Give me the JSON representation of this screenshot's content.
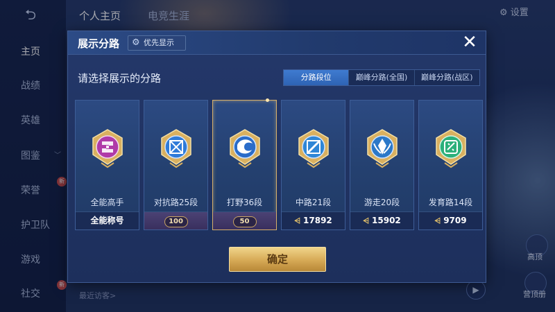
{
  "background": {
    "back_label": "⮌",
    "nav": [
      {
        "label": "主页",
        "active": true
      },
      {
        "label": "战绩"
      },
      {
        "label": "英雄"
      },
      {
        "label": "图鉴"
      },
      {
        "label": "荣誉"
      },
      {
        "label": "护卫队"
      },
      {
        "label": "游戏"
      },
      {
        "label": "社交"
      }
    ],
    "new_badge": "新",
    "top_tabs": [
      "个人主页",
      "电竞生涯"
    ],
    "settings_label": "设置",
    "recent_visitor": "最近访客>",
    "side_labels": [
      "高顶",
      "营顶册"
    ]
  },
  "modal": {
    "title": "展示分路",
    "priority_label": "优先显示",
    "close_label": "✕",
    "subtitle": "请选择展示的分路",
    "segments": [
      "分路段位",
      "巅峰分路(全国)",
      "巅峰分路(战区)"
    ],
    "active_segment": 0,
    "cards": [
      {
        "name": "全能高手",
        "foot": "全能称号",
        "foot_type": "text",
        "badge_color": "#b03aa8"
      },
      {
        "name": "对抗路25段",
        "foot": "100",
        "foot_type": "plate",
        "badge_color": "#2f7bd8"
      },
      {
        "name": "打野36段",
        "foot": "50",
        "foot_type": "plate",
        "badge_color": "#2a6cc9",
        "selected": true
      },
      {
        "name": "中路21段",
        "foot": "17892",
        "foot_type": "score",
        "badge_color": "#2e86d6"
      },
      {
        "name": "游走20段",
        "foot": "15902",
        "foot_type": "score",
        "badge_color": "#2b78c8"
      },
      {
        "name": "发育路14段",
        "foot": "9709",
        "foot_type": "score",
        "badge_color": "#2bb07a"
      }
    ],
    "confirm_label": "确定"
  },
  "colors": {
    "accent_blue": "#2e63b4",
    "gold": "#d6a955",
    "panel": "#1d2f5c"
  }
}
